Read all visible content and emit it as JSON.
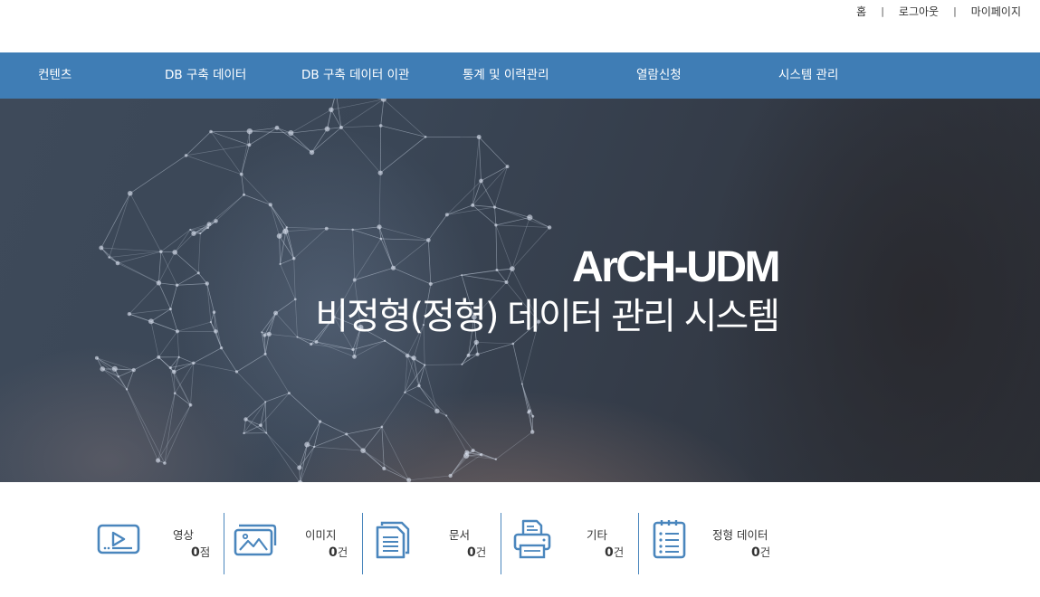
{
  "top_links": {
    "home": "홈",
    "logout": "로그아웃",
    "mypage": "마이페이지",
    "separator": "|"
  },
  "nav": {
    "items": [
      {
        "label": "컨텐츠"
      },
      {
        "label": "DB 구축 데이터"
      },
      {
        "label": "DB 구축 데이터 이관"
      },
      {
        "label": "통계 및 이력관리"
      },
      {
        "label": "열람신청"
      },
      {
        "label": "시스템 관리"
      }
    ]
  },
  "hero": {
    "title_en": "ArCH-UDM",
    "title_ko": "비정형(정형) 데이터 관리 시스템"
  },
  "stats": [
    {
      "label": "영상",
      "count": "0",
      "unit": "점",
      "icon": "video-icon"
    },
    {
      "label": "이미지",
      "count": "0",
      "unit": "건",
      "icon": "image-icon"
    },
    {
      "label": "문서",
      "count": "0",
      "unit": "건",
      "icon": "document-icon"
    },
    {
      "label": "기타",
      "count": "0",
      "unit": "건",
      "icon": "printer-icon"
    },
    {
      "label": "정형 데이터",
      "count": "0",
      "unit": "건",
      "icon": "clipboard-list-icon"
    }
  ],
  "colors": {
    "nav_bg": "#3f7db5",
    "icon_stroke": "#4a86bd"
  }
}
